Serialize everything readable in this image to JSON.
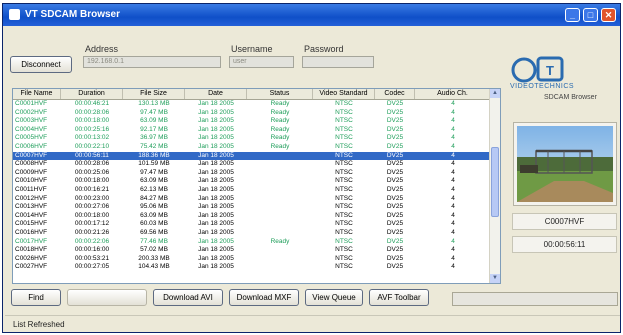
{
  "window": {
    "title": "VT SDCAM Browser",
    "min_glyph": "_",
    "max_glyph": "□",
    "close_glyph": "✕"
  },
  "connection": {
    "disconnect_label": "Disconnect",
    "address_label": "Address",
    "address_value": "192.168.0.1",
    "username_label": "Username",
    "username_value": "user",
    "password_label": "Password",
    "password_value": ""
  },
  "brand": {
    "name": "VIDEOTECHNICS",
    "product": "SDCAM Browser"
  },
  "table": {
    "columns": [
      "File Name",
      "Duration",
      "File Size",
      "Date",
      "Status",
      "Video Standard",
      "Codec",
      "Audio Ch."
    ],
    "rows": [
      {
        "cells": [
          "C0001HVF",
          "00:00:46:21",
          "130.13 MB",
          "Jan 18 2005",
          "Ready",
          "NTSC",
          "DV25",
          "4"
        ],
        "state": "ready"
      },
      {
        "cells": [
          "C0002HVF",
          "00:00:28:06",
          "97.47 MB",
          "Jan 18 2005",
          "Ready",
          "NTSC",
          "DV25",
          "4"
        ],
        "state": "ready"
      },
      {
        "cells": [
          "C0003HVF",
          "00:00:18:00",
          "63.09 MB",
          "Jan 18 2005",
          "Ready",
          "NTSC",
          "DV25",
          "4"
        ],
        "state": "ready"
      },
      {
        "cells": [
          "C0004HVF",
          "00:00:25:16",
          "92.17 MB",
          "Jan 18 2005",
          "Ready",
          "NTSC",
          "DV25",
          "4"
        ],
        "state": "ready"
      },
      {
        "cells": [
          "C0005HVF",
          "00:00:13:02",
          "36.97 MB",
          "Jan 18 2005",
          "Ready",
          "NTSC",
          "DV25",
          "4"
        ],
        "state": "ready"
      },
      {
        "cells": [
          "C0006HVF",
          "00:00:22:10",
          "75.42 MB",
          "Jan 18 2005",
          "Ready",
          "NTSC",
          "DV25",
          "4"
        ],
        "state": "ready"
      },
      {
        "cells": [
          "C0007HVF",
          "00:00:56:11",
          "188.36 MB",
          "Jan 18 2005",
          "",
          "NTSC",
          "DV25",
          "4"
        ],
        "state": "sel"
      },
      {
        "cells": [
          "C0008HVF",
          "00:00:28:06",
          "101.59 MB",
          "Jan 18 2005",
          "",
          "NTSC",
          "DV25",
          "4"
        ],
        "state": ""
      },
      {
        "cells": [
          "C0009HVF",
          "00:00:25:06",
          "97.47 MB",
          "Jan 18 2005",
          "",
          "NTSC",
          "DV25",
          "4"
        ],
        "state": ""
      },
      {
        "cells": [
          "C0010HVF",
          "00:00:18:00",
          "63.09 MB",
          "Jan 18 2005",
          "",
          "NTSC",
          "DV25",
          "4"
        ],
        "state": ""
      },
      {
        "cells": [
          "C0011HVF",
          "00:00:16:21",
          "62.13 MB",
          "Jan 18 2005",
          "",
          "NTSC",
          "DV25",
          "4"
        ],
        "state": ""
      },
      {
        "cells": [
          "C0012HVF",
          "00:00:23:00",
          "84.27 MB",
          "Jan 18 2005",
          "",
          "NTSC",
          "DV25",
          "4"
        ],
        "state": ""
      },
      {
        "cells": [
          "C0013HVF",
          "00:00:27:06",
          "95.06 MB",
          "Jan 18 2005",
          "",
          "NTSC",
          "DV25",
          "4"
        ],
        "state": ""
      },
      {
        "cells": [
          "C0014HVF",
          "00:00:18:00",
          "63.09 MB",
          "Jan 18 2005",
          "",
          "NTSC",
          "DV25",
          "4"
        ],
        "state": ""
      },
      {
        "cells": [
          "C0015HVF",
          "00:00:17:12",
          "60.03 MB",
          "Jan 18 2005",
          "",
          "NTSC",
          "DV25",
          "4"
        ],
        "state": ""
      },
      {
        "cells": [
          "C0016HVF",
          "00:00:21:26",
          "69.56 MB",
          "Jan 18 2005",
          "",
          "NTSC",
          "DV25",
          "4"
        ],
        "state": ""
      },
      {
        "cells": [
          "C0017HVF",
          "00:00:22:06",
          "77.46 MB",
          "Jan 18 2005",
          "Ready",
          "NTSC",
          "DV25",
          "4"
        ],
        "state": "ready"
      },
      {
        "cells": [
          "C0018HVF",
          "00:00:16:00",
          "57.02 MB",
          "Jan 18 2005",
          "",
          "NTSC",
          "DV25",
          "4"
        ],
        "state": ""
      },
      {
        "cells": [
          "C0026HVF",
          "00:00:53:21",
          "200.33 MB",
          "Jan 18 2005",
          "",
          "NTSC",
          "DV25",
          "4"
        ],
        "state": ""
      },
      {
        "cells": [
          "C0027HVF",
          "00:00:27:05",
          "104.43 MB",
          "Jan 18 2005",
          "",
          "NTSC",
          "DV25",
          "4"
        ],
        "state": ""
      }
    ]
  },
  "preview": {
    "file_name": "C0007HVF",
    "duration": "00:00:56:11"
  },
  "toolbar": {
    "find_label": "Find",
    "blank_label": "",
    "download_avi_label": "Download AVI",
    "download_mxf_label": "Download MXF",
    "view_queue_label": "View Queue",
    "avf_toolbar_label": "AVF Toolbar"
  },
  "status": {
    "text": "List Refreshed"
  },
  "colors": {
    "title_bar": "#0f4fc8",
    "ready_text": "#1e9e5a",
    "selection": "#3169c6",
    "brand": "#2a6bb0"
  }
}
